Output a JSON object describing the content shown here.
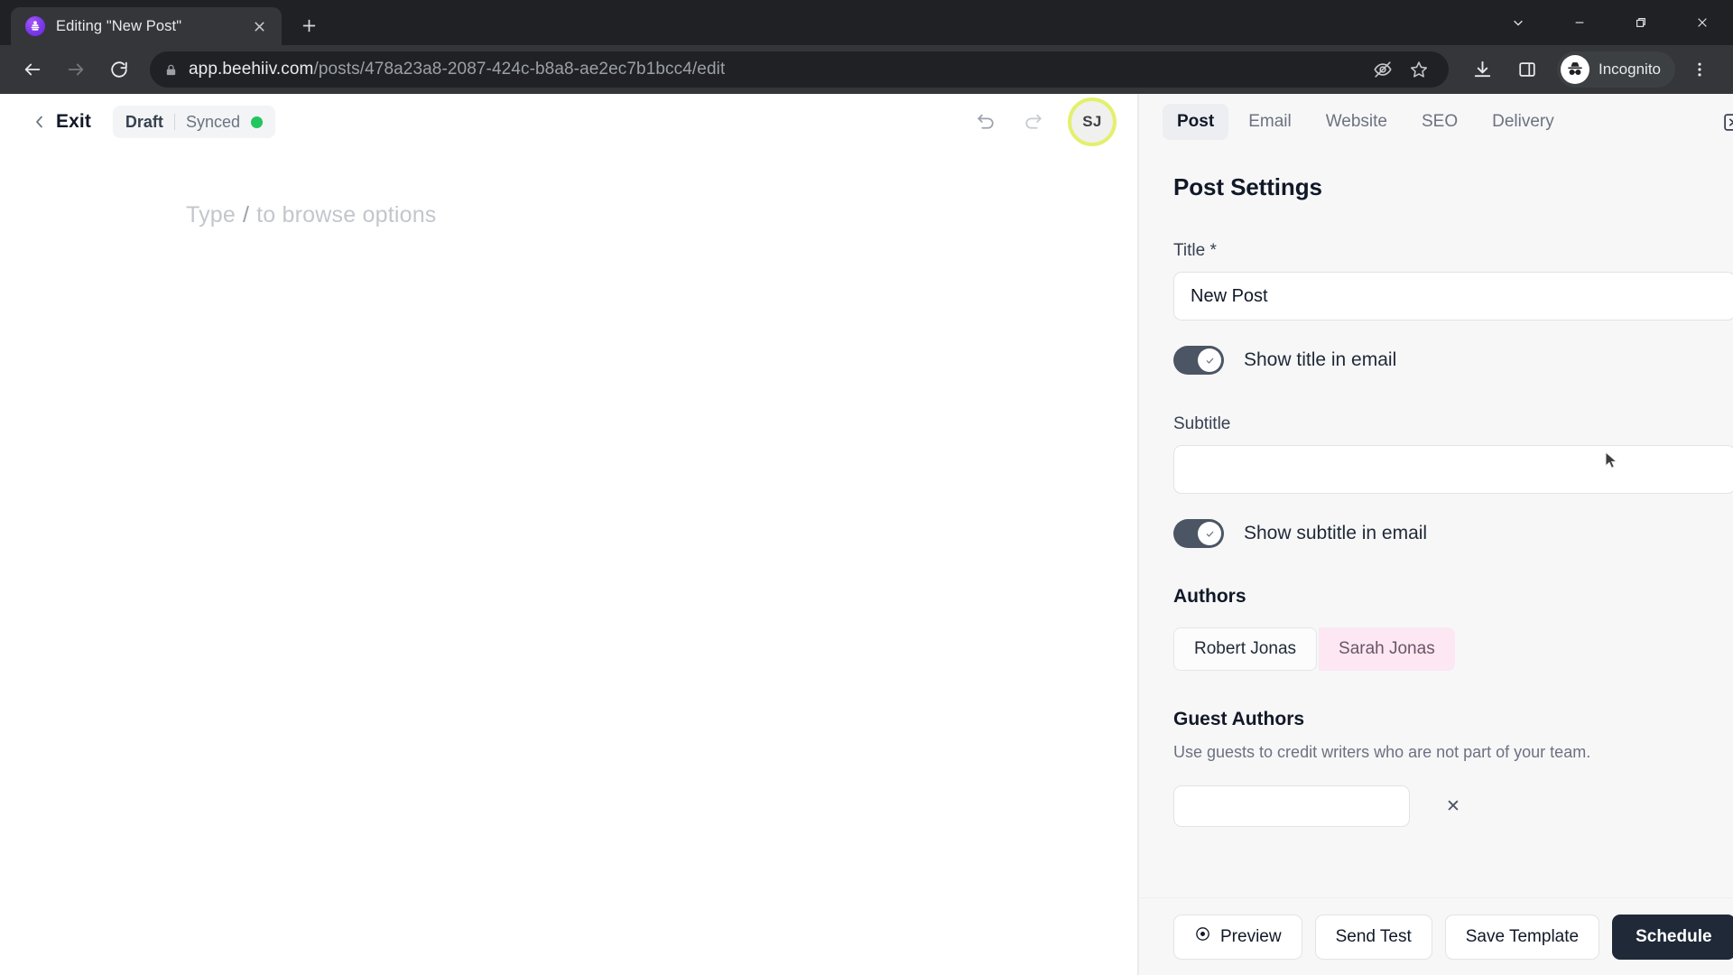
{
  "browser": {
    "tab": {
      "title": "Editing \"New Post\"",
      "favicon": "beehiiv-icon",
      "close": "×"
    },
    "newtab_label": "+",
    "window_controls": {
      "tab_search": "tab-search-icon",
      "minimize": "minimize-icon",
      "maximize": "maximize-icon",
      "close": "close-icon"
    },
    "nav": {
      "back": "back-arrow-icon",
      "forward": "forward-arrow-icon",
      "reload": "reload-icon"
    },
    "omnibox": {
      "lock": "lock-icon",
      "url_host": "app.beehiiv.com",
      "url_path": "/posts/478a23a8-2087-424c-b8a8-ae2ec7b1bcc4/edit",
      "full_url": "app.beehiiv.com/posts/478a23a8-2087-424c-b8a8-ae2ec7b1bcc4/edit",
      "tracking_protection": "eye-slash-icon",
      "bookmark": "star-icon"
    },
    "toolbar_icons": {
      "downloads": "download-icon",
      "side_panel": "side-panel-icon",
      "menu": "three-dot-menu-icon"
    },
    "profile": {
      "label": "Incognito",
      "icon": "incognito-icon"
    }
  },
  "editor": {
    "exit_label": "Exit",
    "back_chevron": "chevron-left-icon",
    "status": {
      "draft": "Draft",
      "synced": "Synced",
      "dot_color": "#22c55e"
    },
    "undo": "undo-icon",
    "redo": "redo-icon",
    "avatar": {
      "initials": "SJ",
      "ring_color": "#e3f06b"
    },
    "placeholder_before": "Type",
    "placeholder_slash": "/",
    "placeholder_after": "to browse options"
  },
  "panel": {
    "tabs": [
      {
        "label": "Post",
        "active": true
      },
      {
        "label": "Email",
        "active": false
      },
      {
        "label": "Website",
        "active": false
      },
      {
        "label": "SEO",
        "active": false
      },
      {
        "label": "Delivery",
        "active": false
      }
    ],
    "collapse_icon": "collapse-panel-icon",
    "title": "Post Settings",
    "title_field": {
      "label": "Title *",
      "value": "New Post",
      "placeholder": ""
    },
    "show_title_toggle": {
      "label": "Show title in email",
      "checked": true
    },
    "subtitle_field": {
      "label": "Subtitle",
      "value": "",
      "placeholder": ""
    },
    "show_subtitle_toggle": {
      "label": "Show subtitle in email",
      "checked": true
    },
    "authors": {
      "heading": "Authors",
      "items": [
        {
          "name": "Robert Jonas",
          "style": "plain"
        },
        {
          "name": "Sarah Jonas",
          "style": "pink"
        }
      ]
    },
    "guest_authors": {
      "heading": "Guest Authors",
      "description": "Use guests to credit writers who are not part of your team.",
      "input_value": "",
      "caret": "▲",
      "x_mark": "✕"
    }
  },
  "footer": {
    "preview": {
      "label": "Preview",
      "icon": "eye-icon"
    },
    "send_test": {
      "label": "Send Test"
    },
    "save_template": {
      "label": "Save Template"
    },
    "schedule": {
      "label": "Schedule",
      "bg": "#1f2937"
    }
  }
}
